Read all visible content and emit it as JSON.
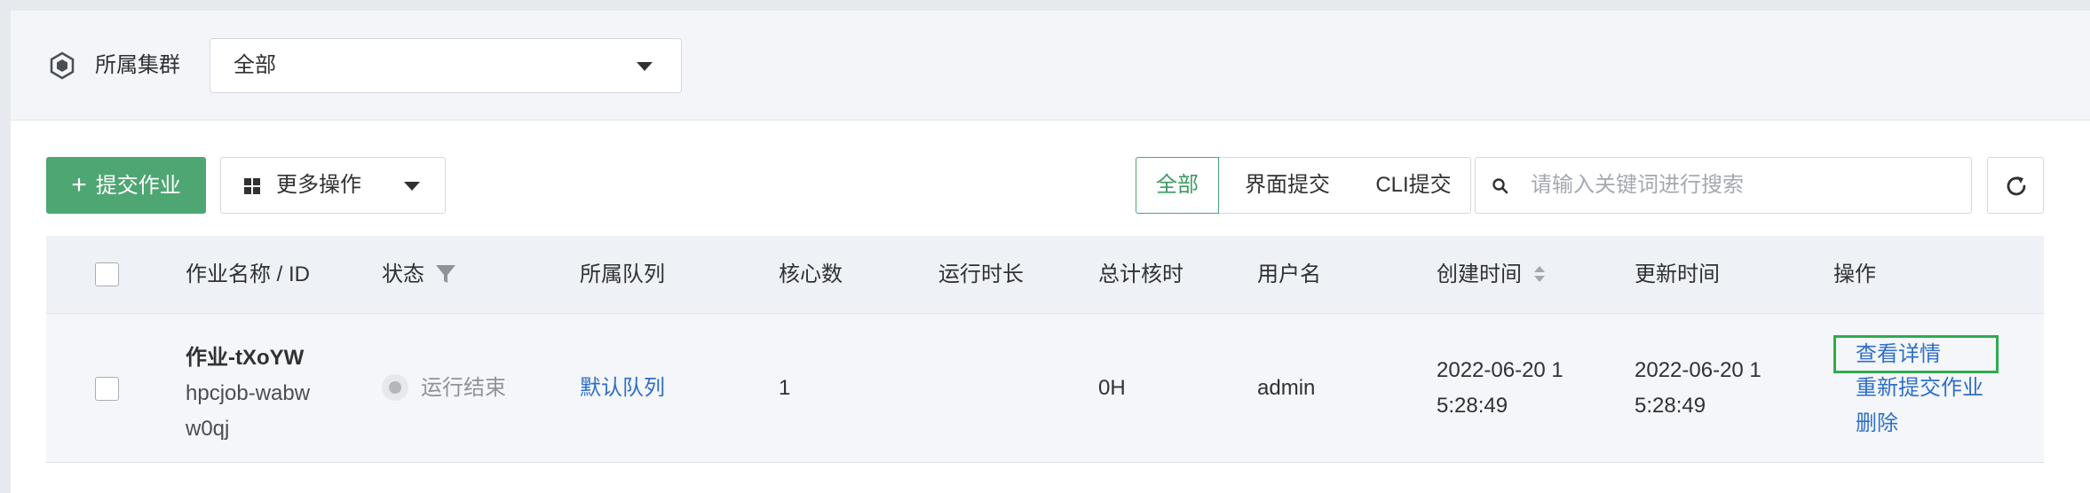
{
  "cluster": {
    "label": "所属集群",
    "selected": "全部",
    "icon": "cluster-cube-icon"
  },
  "toolbar": {
    "submit_label": "提交作业",
    "more_label": "更多操作",
    "filter_tabs": [
      "全部",
      "界面提交",
      "CLI提交"
    ],
    "active_tab": "全部",
    "search_placeholder": "请输入关键词进行搜索",
    "search_value": ""
  },
  "table": {
    "headers": {
      "name": "作业名称 / ID",
      "status": "状态",
      "queue": "所属队列",
      "cores": "核心数",
      "runtime": "运行时长",
      "corehours": "总计核时",
      "user": "用户名",
      "created": "创建时间",
      "updated": "更新时间",
      "actions": "操作"
    },
    "rows": [
      {
        "name": "作业-tXoYW",
        "id": "hpcjob-wabww0qj",
        "status": "运行结束",
        "queue": "默认队列",
        "cores": "1",
        "runtime": "",
        "corehours": "0H",
        "user": "admin",
        "created": "2022-06-20 15:28:49",
        "updated": "2022-06-20 15:28:49",
        "actions": [
          "查看详情",
          "重新提交作业",
          "删除"
        ]
      }
    ]
  },
  "colors": {
    "primary": "#4ea672",
    "link": "#2f6fc9",
    "highlight_border": "#2eab4e",
    "header_bg": "#eef1f5"
  }
}
